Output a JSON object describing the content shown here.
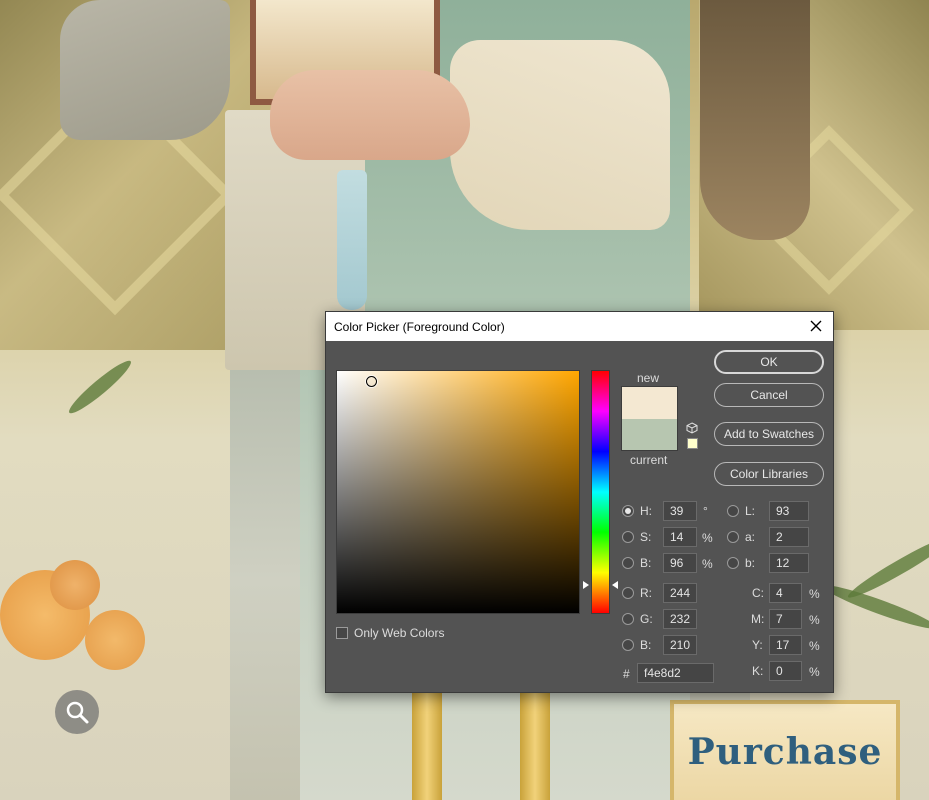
{
  "background": {
    "sign_text": "Purchase"
  },
  "dialog": {
    "title": "Color Picker (Foreground Color)",
    "new_label": "new",
    "current_label": "current",
    "new_color": "#f4e8d2",
    "current_color": "#b7c6b0",
    "websafe_color": "#ffffcc",
    "buttons": {
      "ok": "OK",
      "cancel": "Cancel",
      "add_to_swatches": "Add to Swatches",
      "color_libraries": "Color Libraries"
    },
    "hsb": {
      "h_label": "H:",
      "h_value": "39",
      "h_unit": "°",
      "s_label": "S:",
      "s_value": "14",
      "s_unit": "%",
      "b_label": "B:",
      "b_value": "96",
      "b_unit": "%"
    },
    "rgb": {
      "r_label": "R:",
      "r_value": "244",
      "g_label": "G:",
      "g_value": "232",
      "b_label": "B:",
      "b_value": "210"
    },
    "lab": {
      "l_label": "L:",
      "l_value": "93",
      "a_label": "a:",
      "a_value": "2",
      "b_label": "b:",
      "b_value": "12"
    },
    "cmyk": {
      "c_label": "C:",
      "c_value": "4",
      "c_unit": "%",
      "m_label": "M:",
      "m_value": "7",
      "m_unit": "%",
      "y_label": "Y:",
      "y_value": "17",
      "y_unit": "%",
      "k_label": "K:",
      "k_value": "0",
      "k_unit": "%"
    },
    "hex_label": "#",
    "hex_value": "f4e8d2",
    "only_web_colors_label": "Only Web Colors",
    "only_web_colors_checked": false,
    "selected_channel": "H"
  }
}
